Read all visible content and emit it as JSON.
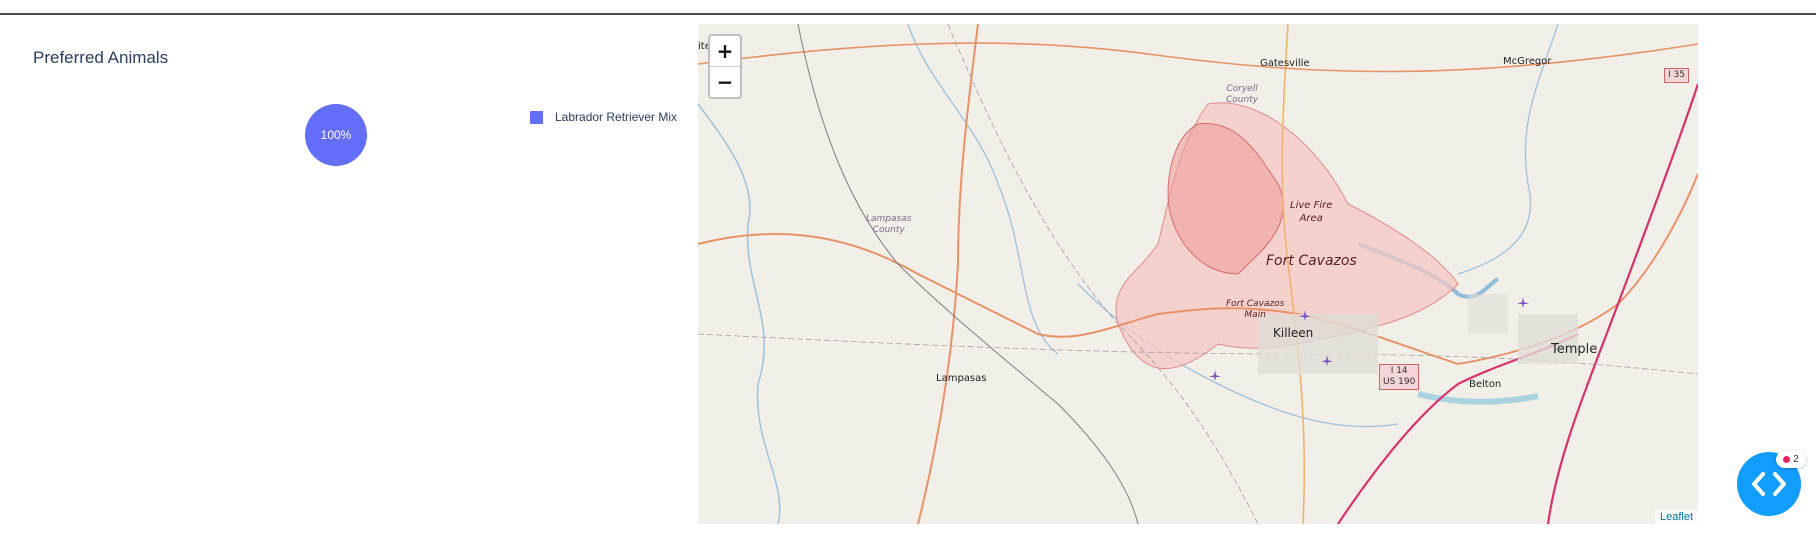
{
  "panel": {
    "title": "Preferred Animals"
  },
  "chart_data": {
    "type": "pie",
    "labels": [
      "Labrador Retriever Mix"
    ],
    "values": [
      100
    ],
    "text_labels": [
      "100%"
    ],
    "colors": [
      "#636efa"
    ]
  },
  "legend": {
    "items": [
      {
        "label": "Labrador Retriever Mix",
        "color": "#636efa"
      }
    ]
  },
  "map": {
    "zoom_in": "+",
    "zoom_out": "−",
    "attribution": "Leaflet",
    "edge_fragment": "ite",
    "places": {
      "gatesville": "Gatesville",
      "mcgregor": "McGregor",
      "coryell": "Coryell\nCounty",
      "lampasas_county": "Lampasas\nCounty",
      "live_fire": "Live Fire\nArea",
      "fort_cavazos": "Fort Cavazos",
      "fort_cavazos_main": "Fort Cavazos\nMain",
      "killeen": "Killeen",
      "lampasas": "Lampasas",
      "belton": "Belton",
      "temple": "Temple"
    },
    "shields": {
      "i35": "I 35",
      "i14": "I 14\nUS 190"
    }
  },
  "fab": {
    "badge_count": "2"
  }
}
